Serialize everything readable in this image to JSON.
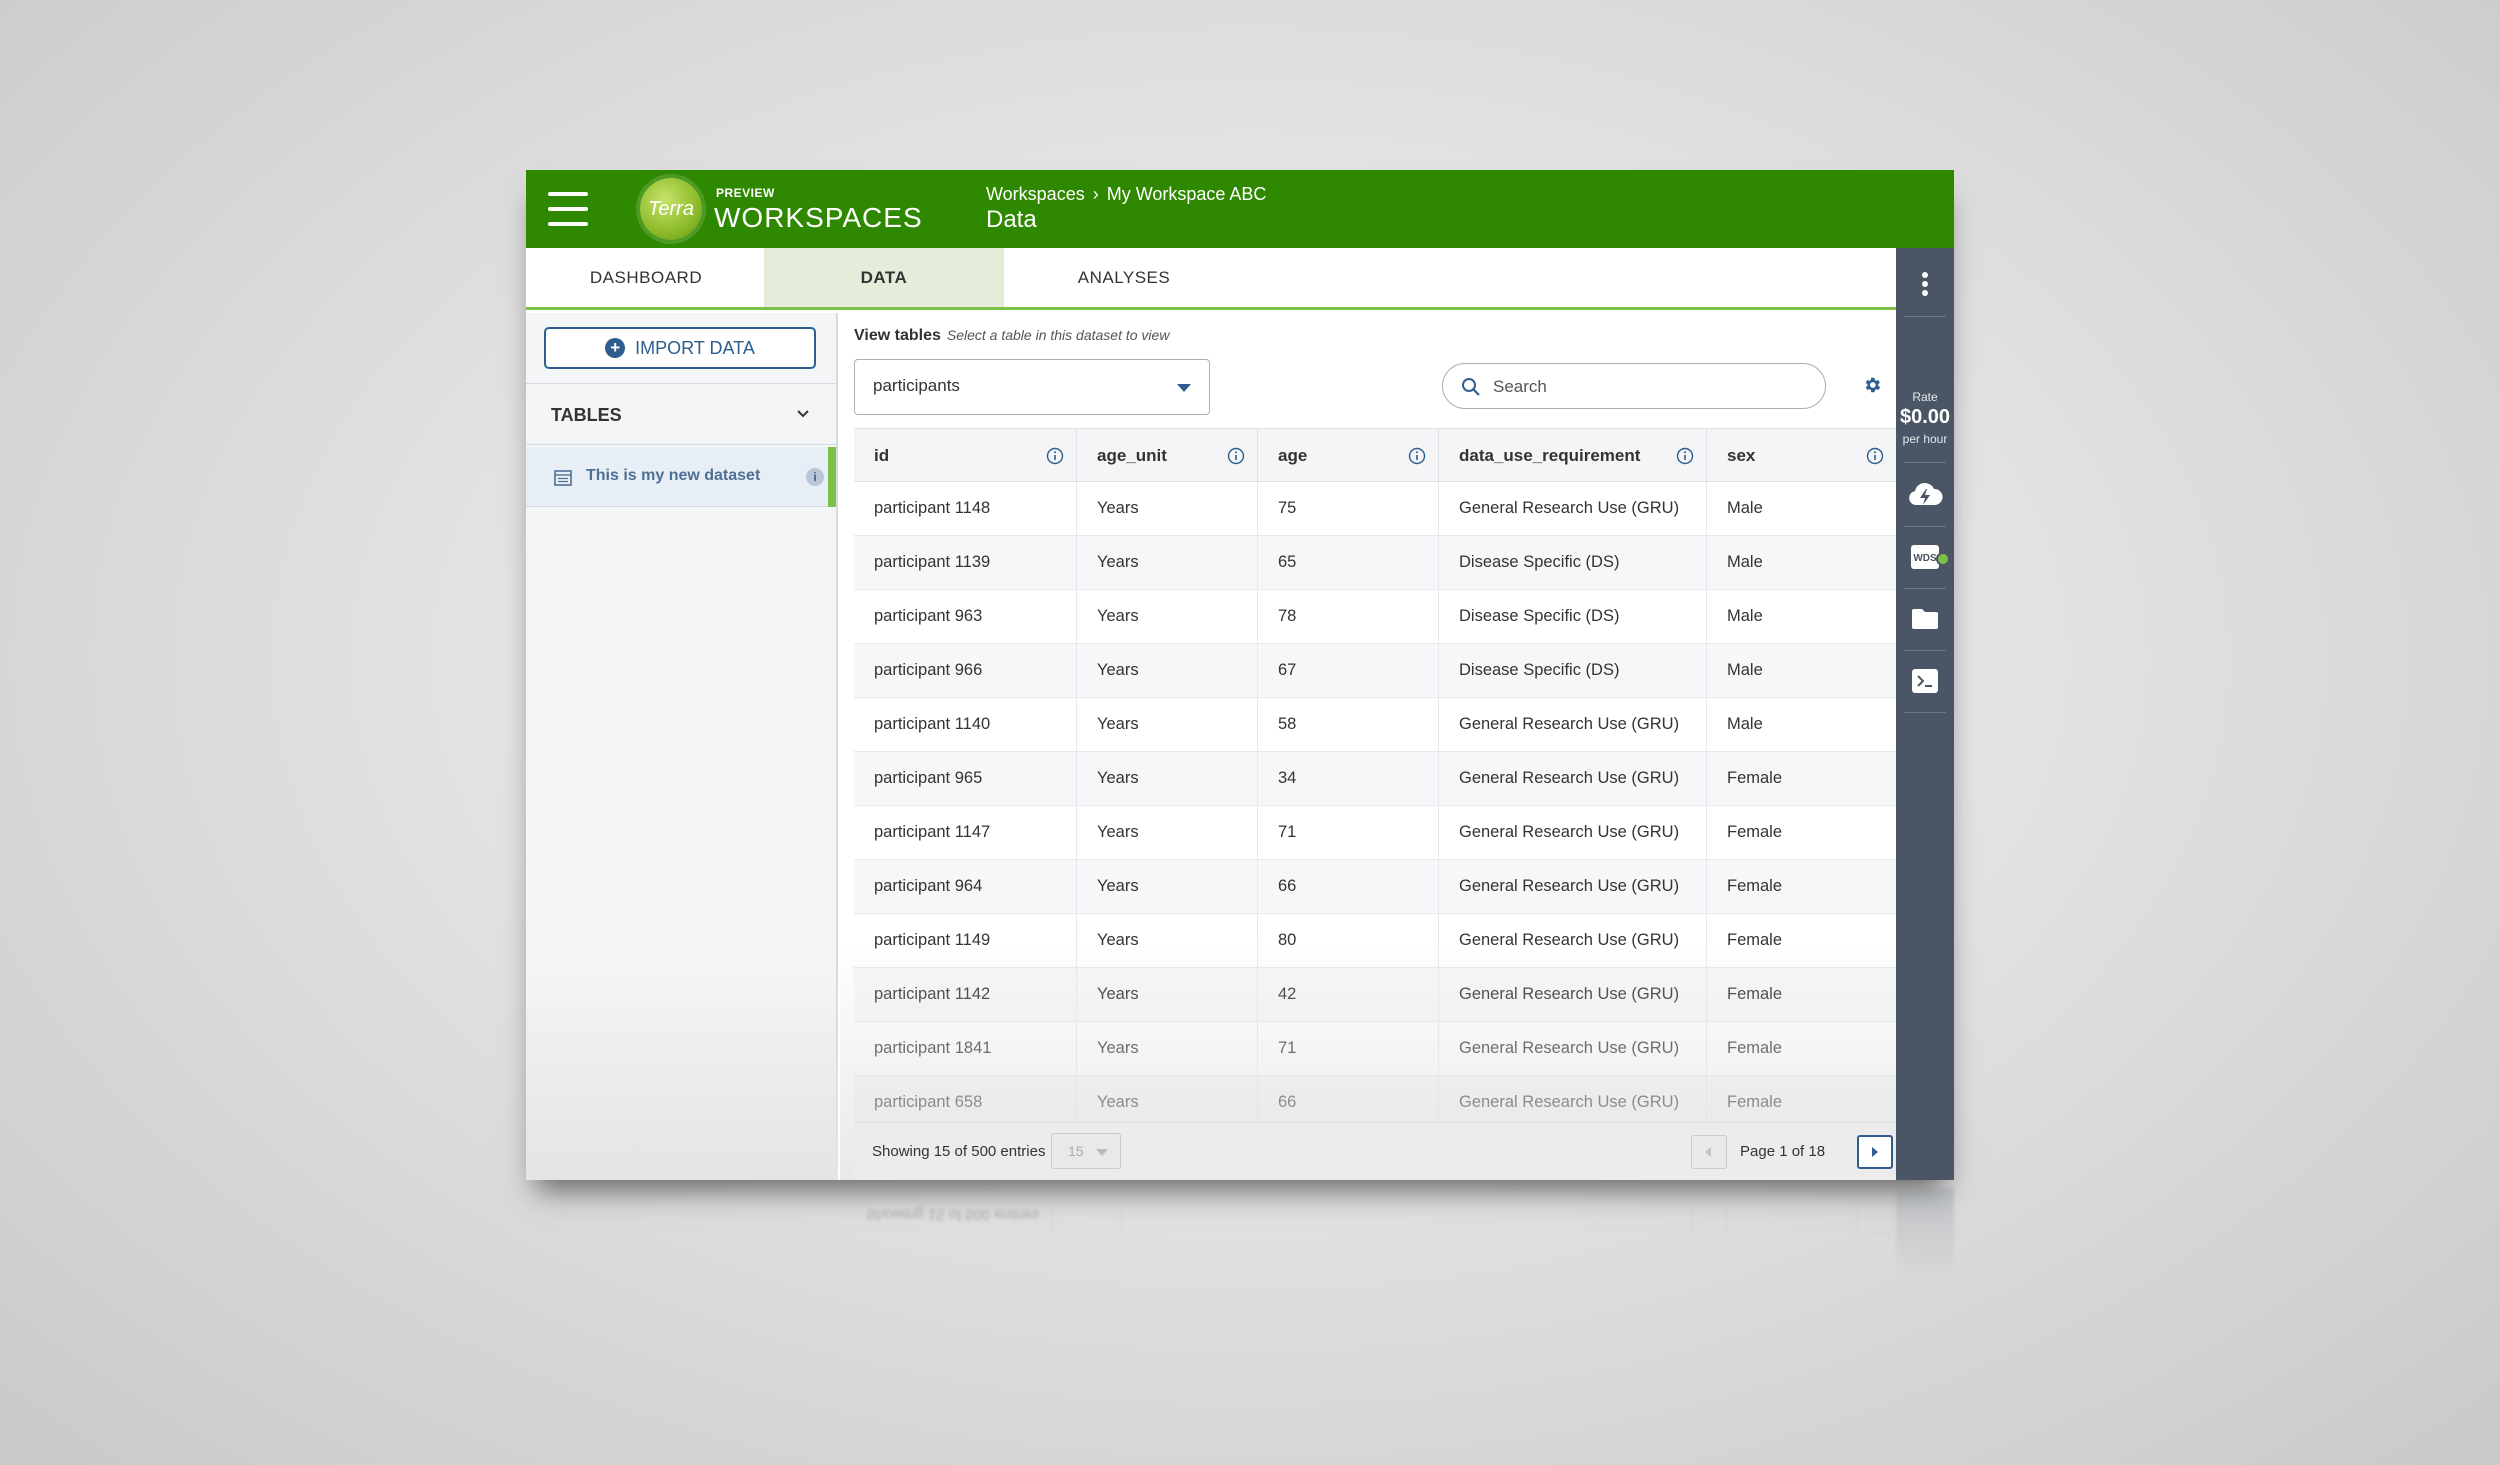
{
  "header": {
    "preview_label": "PREVIEW",
    "brand": "WORKSPACES",
    "logo_text": "Terra",
    "breadcrumb": [
      "Workspaces",
      "My Workspace ABC"
    ],
    "breadcrumb_sep": "›",
    "page_title": "Data",
    "background_color": "#2f8900"
  },
  "tabs": [
    {
      "label": "DASHBOARD",
      "active": false
    },
    {
      "label": "DATA",
      "active": true
    },
    {
      "label": "ANALYSES",
      "active": false
    }
  ],
  "sidebar": {
    "import_button": "IMPORT DATA",
    "tables_title": "TABLES",
    "dataset_item": "This is my new dataset",
    "dataset_info": "i"
  },
  "main": {
    "view_tables_label": "View tables",
    "view_tables_hint": "Select a table in this dataset to view",
    "selected_table": "participants",
    "search_placeholder": "Search"
  },
  "table": {
    "columns": [
      "id",
      "age_unit",
      "age",
      "data_use_requirement",
      "sex"
    ],
    "rows": [
      [
        "participant 1148",
        "Years",
        "75",
        "General Research Use (GRU)",
        "Male"
      ],
      [
        "participant 1139",
        "Years",
        "65",
        "Disease Specific (DS)",
        "Male"
      ],
      [
        "participant 963",
        "Years",
        "78",
        "Disease Specific (DS)",
        "Male"
      ],
      [
        "participant 966",
        "Years",
        "67",
        "Disease Specific (DS)",
        "Male"
      ],
      [
        "participant 1140",
        "Years",
        "58",
        "General Research Use (GRU)",
        "Male"
      ],
      [
        "participant 965",
        "Years",
        "34",
        "General Research Use (GRU)",
        "Female"
      ],
      [
        "participant 1147",
        "Years",
        "71",
        "General Research Use (GRU)",
        "Female"
      ],
      [
        "participant 964",
        "Years",
        "66",
        "General Research Use (GRU)",
        "Female"
      ],
      [
        "participant 1149",
        "Years",
        "80",
        "General Research Use (GRU)",
        "Female"
      ],
      [
        "participant 1142",
        "Years",
        "42",
        "General Research Use (GRU)",
        "Female"
      ],
      [
        "participant 1841",
        "Years",
        "71",
        "General Research Use (GRU)",
        "Female"
      ],
      [
        "participant 658",
        "Years",
        "66",
        "General Research Use (GRU)",
        "Female"
      ]
    ]
  },
  "pagination": {
    "showing": "Showing 15 of 500 entries",
    "per_page": "15",
    "page_text": "Page 1 of 18"
  },
  "rail": {
    "rate_label": "Rate",
    "rate_value": "$0.00",
    "rate_unit": "per hour",
    "wds_label": "WDS",
    "icons": [
      "kebab-menu-icon",
      "cloud-compute-icon",
      "wds-icon",
      "folder-icon",
      "terminal-icon"
    ]
  },
  "colors": {
    "accent_green": "#7cc046",
    "link_blue": "#2d5e8e",
    "rail_gray": "#4a5565"
  }
}
